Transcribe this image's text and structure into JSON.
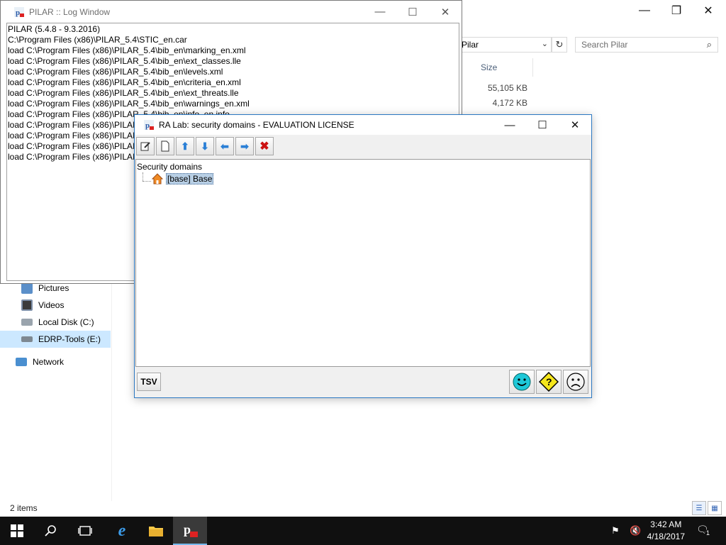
{
  "explorer": {
    "address_text": "Pilar",
    "search_placeholder": "Search Pilar",
    "column_size": "Size",
    "sizes": [
      "55,105 KB",
      "4,172 KB"
    ],
    "nav_items": [
      {
        "label": "Pictures",
        "icon": "pictures-icon"
      },
      {
        "label": "Videos",
        "icon": "videos-icon"
      },
      {
        "label": "Local Disk (C:)",
        "icon": "disk-icon"
      },
      {
        "label": "EDRP-Tools (E:)",
        "icon": "usb-drive-icon"
      },
      {
        "label": "Network",
        "icon": "network-icon"
      }
    ],
    "status_items": "2 items"
  },
  "log_window": {
    "title": "PILAR :: Log Window",
    "lines": [
      "PILAR (5.4.8 - 9.3.2016)",
      "C:\\Program Files (x86)\\PILAR_5.4\\STIC_en.car",
      "load C:\\Program Files (x86)\\PILAR_5.4\\bib_en\\marking_en.xml",
      "load C:\\Program Files (x86)\\PILAR_5.4\\bib_en\\ext_classes.lle",
      "load C:\\Program Files (x86)\\PILAR_5.4\\bib_en\\levels.xml",
      "load C:\\Program Files (x86)\\PILAR_5.4\\bib_en\\criteria_en.xml",
      "load C:\\Program Files (x86)\\PILAR_5.4\\bib_en\\ext_threats.lle",
      "load C:\\Program Files (x86)\\PILAR_5.4\\bib_en\\warnings_en.xml",
      "load C:\\Program Files (x86)\\PILAR_5.4\\bib_en\\info_en.info",
      "load C:\\Program Files (x86)\\PILAR_5.4\\bib_en\\",
      "load C:\\Program Files (x86)\\PILAR_5.4\\bib_en\\",
      "load C:\\Program Files (x86)\\PILAR_5.4\\bib_en\\",
      "load C:\\Program Files (x86)\\PILAR_5.4\\bib_en\\"
    ]
  },
  "ralab": {
    "title": "RA Lab: security domains - EVALUATION LICENSE",
    "tree_root": "Security domains",
    "tree_node": "[base] Base",
    "tsv_label": "TSV"
  },
  "taskbar": {
    "time": "3:42 AM",
    "date": "4/18/2017",
    "notification_count": "1"
  },
  "colors": {
    "accent_blue": "#2a7fd6",
    "selection": "#b8cfe5",
    "taskbar": "#101010",
    "red_x": "#cc1111"
  }
}
